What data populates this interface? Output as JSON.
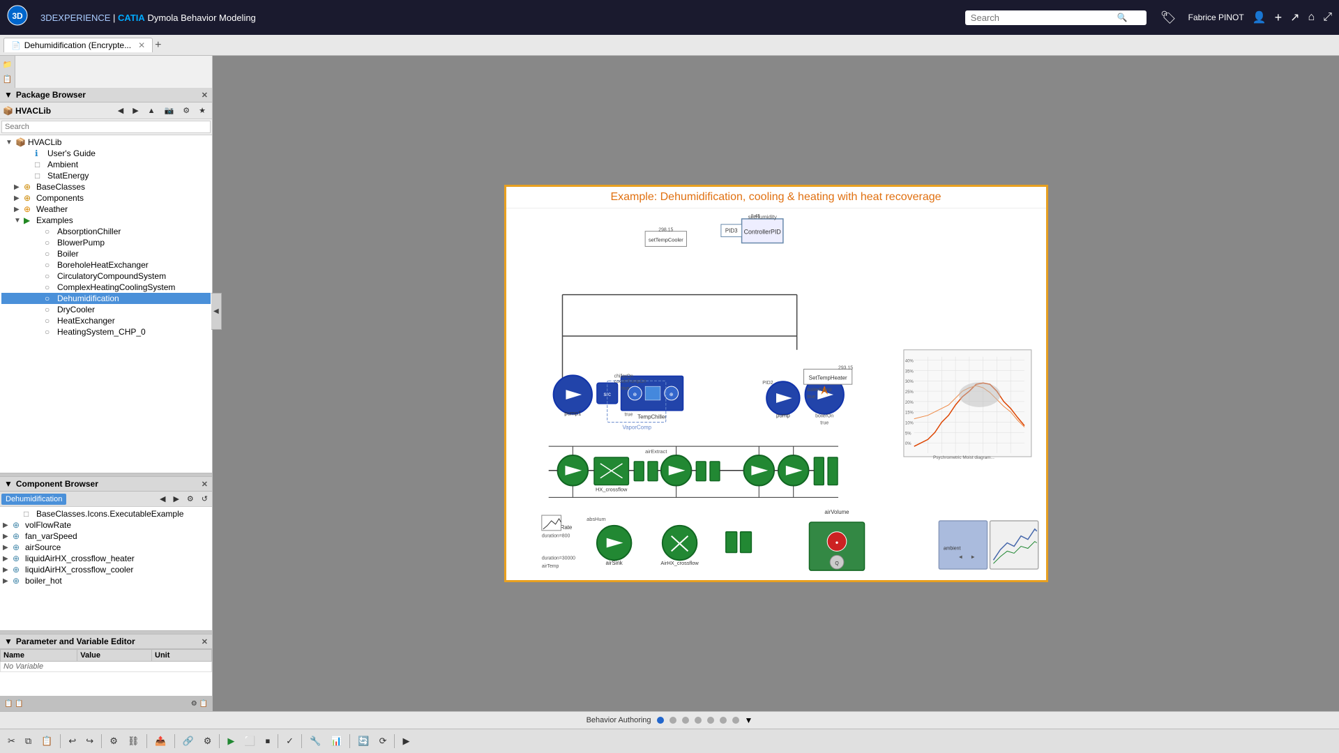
{
  "app": {
    "title": "3DEXPERIENCE",
    "brand": "3DEXPERIENCE | CATIA Dymola Behavior Modeling",
    "user": "Fabrice PINOT",
    "tab_label": "Dehumidification (Encrypte...",
    "tab_add": "+"
  },
  "search": {
    "placeholder": "Search",
    "value": ""
  },
  "package_browser": {
    "title": "Package Browser",
    "root": "HVACLib",
    "items": [
      {
        "id": "users-guide",
        "label": "User's Guide",
        "level": 1,
        "icon": "ℹ",
        "expandable": false
      },
      {
        "id": "ambient",
        "label": "Ambient",
        "level": 1,
        "icon": "□",
        "expandable": false
      },
      {
        "id": "statenergy",
        "label": "StatEnergy",
        "level": 1,
        "icon": "□",
        "expandable": false
      },
      {
        "id": "baseclasses",
        "label": "BaseClasses",
        "level": 0,
        "icon": "⊕",
        "expandable": true
      },
      {
        "id": "components",
        "label": "Components",
        "level": 0,
        "icon": "⊕",
        "expandable": true
      },
      {
        "id": "weather",
        "label": "Weather",
        "level": 0,
        "icon": "⊕",
        "expandable": true
      },
      {
        "id": "examples",
        "label": "Examples",
        "level": 0,
        "icon": "⊕",
        "expandable": true,
        "expanded": true
      },
      {
        "id": "absorptionchiller",
        "label": "AbsorptionChiller",
        "level": 1,
        "icon": "○",
        "expandable": false
      },
      {
        "id": "blowerpump",
        "label": "BlowerPump",
        "level": 1,
        "icon": "○",
        "expandable": false
      },
      {
        "id": "boiler",
        "label": "Boiler",
        "level": 1,
        "icon": "○",
        "expandable": false
      },
      {
        "id": "boreholeheatexchanger",
        "label": "BoreholeHeatExchanger",
        "level": 1,
        "icon": "○",
        "expandable": false
      },
      {
        "id": "circulatorycompoundsystem",
        "label": "CirculatoryCompoundSystem",
        "level": 1,
        "icon": "○",
        "expandable": false
      },
      {
        "id": "complexheatingcoolingsystem",
        "label": "ComplexHeatingCoolingSystem",
        "level": 1,
        "icon": "○",
        "expandable": false
      },
      {
        "id": "dehumidification",
        "label": "Dehumidification",
        "level": 1,
        "icon": "○",
        "expandable": false,
        "selected": true
      },
      {
        "id": "drycooler",
        "label": "DryCooler",
        "level": 1,
        "icon": "○",
        "expandable": false
      },
      {
        "id": "heatexchanger",
        "label": "HeatExchanger",
        "level": 1,
        "icon": "○",
        "expandable": false
      },
      {
        "id": "heatingsystem_chp_0",
        "label": "HeatingSystem_CHP_0",
        "level": 1,
        "icon": "○",
        "expandable": false
      }
    ]
  },
  "component_browser": {
    "title": "Component Browser",
    "selected_item": "Dehumidification",
    "items": [
      {
        "id": "baseclasses-icons",
        "label": "BaseClasses.Icons.ExecutableExample",
        "level": 1,
        "icon": "□"
      },
      {
        "id": "volflowrate",
        "label": "volFlowRate",
        "level": 0,
        "icon": "⊕"
      },
      {
        "id": "fan-varspeed",
        "label": "fan_varSpeed",
        "level": 0,
        "icon": "⊕"
      },
      {
        "id": "airsource",
        "label": "airSource",
        "level": 0,
        "icon": "⊕"
      },
      {
        "id": "liquidairhx-crossflow-heater",
        "label": "liquidAirHX_crossflow_heater",
        "level": 0,
        "icon": "⊕"
      },
      {
        "id": "liquidairhx-crossflow-cooler",
        "label": "liquidAirHX_crossflow_cooler",
        "level": 0,
        "icon": "⊕"
      },
      {
        "id": "boiler-hot",
        "label": "boiler_hot",
        "level": 0,
        "icon": "⊕"
      }
    ]
  },
  "parameter_editor": {
    "title": "Parameter and Variable Editor",
    "columns": [
      "Name",
      "Value",
      "Unit"
    ],
    "no_variable": "No Variable"
  },
  "diagram": {
    "title": "Example: Dehumidification, cooling & heating with heat recoverage",
    "border_color": "#e8a020"
  },
  "behavior_bar": {
    "label": "Behavior Authoring",
    "dots": 7,
    "active_dot": 0
  },
  "toolbar": {
    "buttons": [
      "✂",
      "📋",
      "📋",
      "↩",
      "↪",
      "⚙",
      "📤",
      "🔗",
      "▶",
      "⬜",
      "⏹",
      "✓",
      "🔧",
      "🔄",
      "⟳",
      "▶"
    ]
  },
  "icons": {
    "search": "🔍",
    "bookmark": "🏷",
    "user": "👤",
    "add": "+",
    "share": "↗",
    "home": "🏠",
    "expand": "⤢",
    "close": "✕",
    "collapse_left": "◀",
    "collapse_right": "▶",
    "nav_back": "◀",
    "nav_forward": "▶",
    "nav_up": "▲",
    "nav_capture": "📷",
    "nav_star": "★"
  }
}
